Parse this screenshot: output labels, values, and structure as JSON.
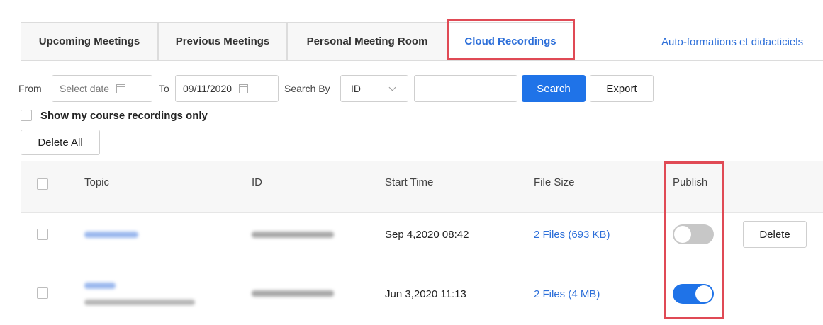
{
  "tabs": [
    {
      "label": "Upcoming Meetings"
    },
    {
      "label": "Previous Meetings"
    },
    {
      "label": "Personal Meeting Room"
    },
    {
      "label": "Cloud Recordings"
    }
  ],
  "header_link": "Auto-formations et didacticiels",
  "filters": {
    "from_label": "From",
    "from_placeholder": "Select date",
    "to_label": "To",
    "to_value": "09/11/2020",
    "search_by_label": "Search By",
    "search_by_value": "ID",
    "search_label": "Search",
    "export_label": "Export"
  },
  "show_only_label": "Show my course recordings only",
  "delete_all_label": "Delete All",
  "table": {
    "columns": [
      "Topic",
      "ID",
      "Start Time",
      "File Size",
      "Publish"
    ],
    "rows": [
      {
        "start_time": "Sep 4,2020 08:42",
        "file_size": "2 Files (693 KB)",
        "published": false,
        "action": "Delete"
      },
      {
        "start_time": "Jun 3,2020 11:13",
        "file_size": "2 Files (4 MB)",
        "published": true
      }
    ]
  },
  "colors": {
    "accent": "#1f73e8",
    "link": "#2d6fd9",
    "highlight": "#e04a55"
  }
}
